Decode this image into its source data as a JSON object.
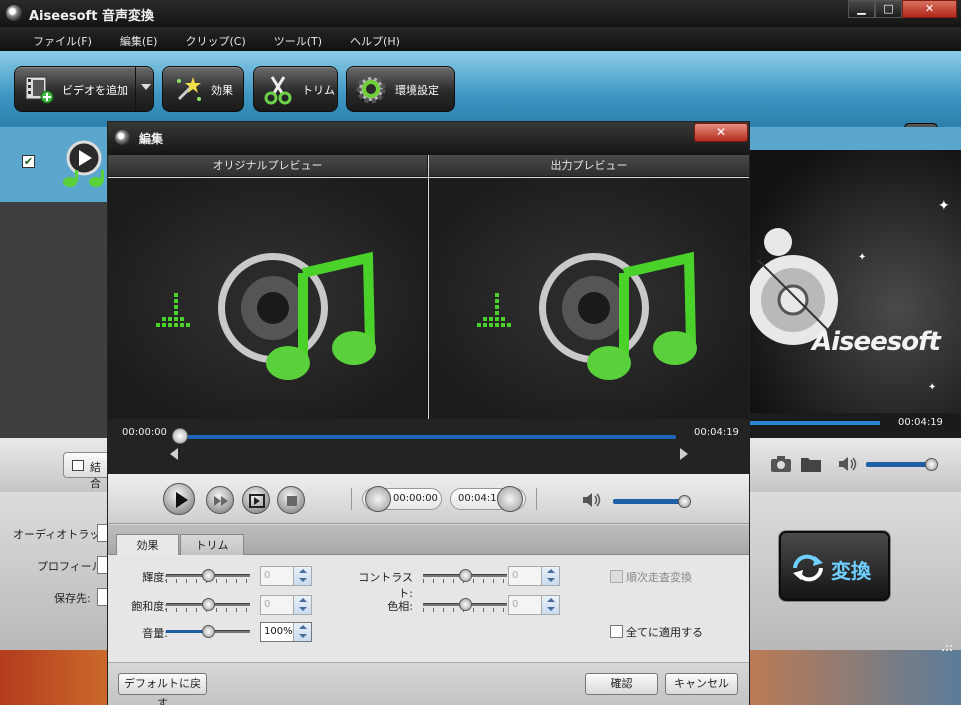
{
  "app": {
    "title": "Aiseesoft 音声変換",
    "window_buttons": [
      "▁",
      "□",
      "✕"
    ]
  },
  "menu": [
    "ファイル(F)",
    "編集(E)",
    "クリップ(C)",
    "ツール(T)",
    "ヘルプ(H)"
  ],
  "toolbar": {
    "add_video": "ビデオを追加",
    "effect": "効果",
    "trim": "トリム",
    "preferences": "環境設定"
  },
  "filelist": {
    "checked_mark": "✔"
  },
  "preview": {
    "brand": "Aiseesoft",
    "time": "00:04:19",
    "progress": 0.62
  },
  "controls": {
    "merge_label": "結合",
    "volume": 0.9
  },
  "settings": {
    "audio_track_label": "オーディオトラック:",
    "profile_label": "プロフィール:",
    "destination_label": "保存先:",
    "convert_label": "変換"
  },
  "dialog": {
    "title": "編集",
    "close": "✕",
    "original_preview": "オリジナルプレビュー",
    "output_preview": "出力プレビュー",
    "timeline": {
      "start": "00:00:00",
      "end": "00:04:19",
      "position": 0.0
    },
    "playback": {
      "start_time": "00:00:00",
      "end_time": "00:04:19",
      "volume": 0.9
    },
    "tabs": {
      "effect": "効果",
      "trim": "トリム"
    },
    "effects": {
      "brightness": {
        "label": "輝度:",
        "value": "0",
        "level": 0.5
      },
      "contrast": {
        "label": "コントラスト:",
        "value": "0",
        "level": 0.5
      },
      "saturation": {
        "label": "飽和度:",
        "value": "0",
        "level": 0.5
      },
      "hue": {
        "label": "色相:",
        "value": "0",
        "level": 0.5
      },
      "volume": {
        "label": "音量:",
        "value": "100%",
        "level": 0.5
      },
      "deinterlace": "順次走査変換",
      "apply_all": "全てに適用する"
    },
    "footer": {
      "default": "デフォルトに戻す",
      "ok": "確認",
      "cancel": "キャンセル"
    }
  },
  "colors": {
    "toolbar_blue": "#3c95c2",
    "accent_blue": "#1f5fa6",
    "note_green": "#5ad13a",
    "close_red": "#b42b1c"
  }
}
